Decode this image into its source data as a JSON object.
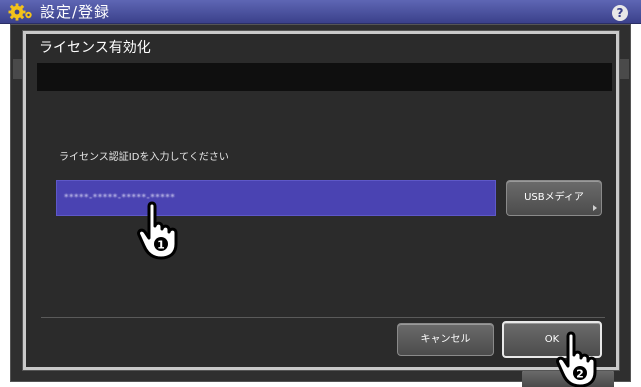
{
  "app": {
    "title": "設定/登録",
    "help_glyph": "?"
  },
  "dialog": {
    "title": "ライセンス有効化",
    "prompt": "ライセンス認証IDを入力してください",
    "license_input": {
      "value": "*****-*****-*****-*****"
    },
    "usb_button_label": "USBメディア",
    "cancel_label": "キャンセル",
    "ok_label": "OK"
  },
  "callouts": {
    "step1": "1",
    "step2": "2"
  },
  "colors": {
    "topbar": "#4a519f",
    "input_bg": "#4a43b2",
    "dialog_bg": "#2b2b2b"
  },
  "icons": [
    "gear-icon",
    "help-icon",
    "hand-pointer-icon",
    "arrow-right-icon"
  ]
}
